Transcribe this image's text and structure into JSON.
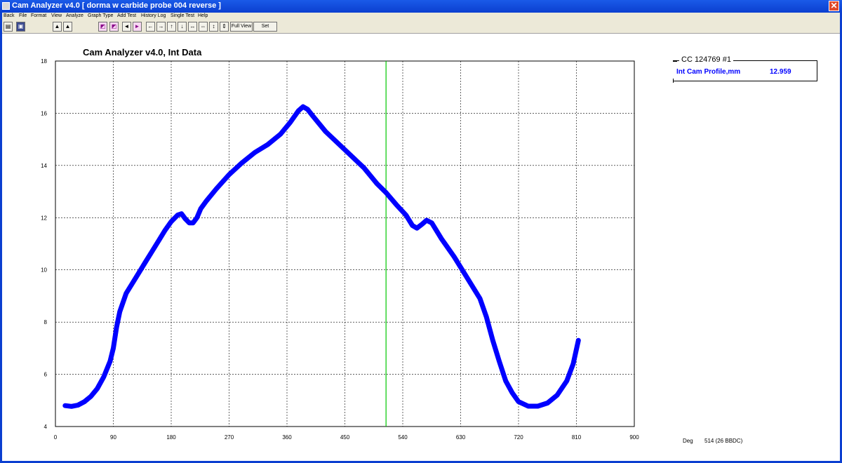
{
  "window": {
    "title": "Cam Analyzer v4.0  [ dorma w carbide probe 004 reverse ]",
    "close_glyph": "✕"
  },
  "menu": [
    "Back",
    "File",
    "Format",
    "View",
    "Analyze",
    "Graph Type",
    "Add Test",
    "History Log",
    "Single Test",
    "Help"
  ],
  "toolbar": {
    "buttons": [
      {
        "name": "print-icon",
        "glyph": "▤",
        "style": "normal"
      },
      {
        "name": "save-icon",
        "glyph": "▣",
        "style": "dark"
      },
      {
        "name": "graph-a-icon",
        "glyph": "▲",
        "style": "normal"
      },
      {
        "name": "graph-b-icon",
        "glyph": "▲",
        "style": "normal"
      },
      {
        "name": "chart-icon",
        "glyph": "◩",
        "style": "pink"
      },
      {
        "name": "chart-edit-icon",
        "glyph": "◩",
        "style": "pink"
      },
      {
        "name": "prev-icon",
        "glyph": "◄",
        "style": "normal"
      },
      {
        "name": "next-icon",
        "glyph": "►",
        "style": "pink"
      },
      {
        "name": "pan-left-icon",
        "glyph": "←",
        "style": "normal"
      },
      {
        "name": "pan-right-icon",
        "glyph": "→",
        "style": "normal"
      },
      {
        "name": "pan-up-icon",
        "glyph": "↑",
        "style": "normal"
      },
      {
        "name": "pan-down-icon",
        "glyph": "↓",
        "style": "normal"
      },
      {
        "name": "zoom-x-in-icon",
        "glyph": "↔",
        "style": "normal"
      },
      {
        "name": "zoom-x-out-icon",
        "glyph": "⇔",
        "style": "normal"
      },
      {
        "name": "zoom-y-in-icon",
        "glyph": "↕",
        "style": "normal"
      },
      {
        "name": "zoom-y-out-icon",
        "glyph": "⇕",
        "style": "normal"
      }
    ],
    "full_view_label": "Full View",
    "set_scales_label": "Set Scales"
  },
  "legend": {
    "title": "CC 124769 #1",
    "label": "Int Cam Profile,mm",
    "value": "12.959",
    "color": "#0000ff"
  },
  "status": {
    "deg_label": "Deg",
    "deg_value": "514 (26 BBDC)"
  },
  "chart_data": {
    "type": "line",
    "title": "Cam Analyzer v4.0,   Int Data",
    "xlabel": "",
    "ylabel": "",
    "xlim": [
      0,
      900
    ],
    "ylim": [
      4,
      18
    ],
    "x_ticks": [
      "0",
      "90",
      "180",
      "270",
      "360",
      "450",
      "540",
      "630",
      "720",
      "810",
      "900"
    ],
    "y_ticks": [
      "4",
      "6",
      "8",
      "10",
      "12",
      "14",
      "16",
      "18"
    ],
    "grid": true,
    "cursor_x": 514,
    "cursor_color": "#00c800",
    "series": [
      {
        "name": "Int Cam Profile,mm",
        "color": "#0000ff",
        "points": [
          [
            15,
            4.8
          ],
          [
            25,
            4.77
          ],
          [
            35,
            4.82
          ],
          [
            45,
            4.95
          ],
          [
            55,
            5.15
          ],
          [
            65,
            5.45
          ],
          [
            75,
            5.9
          ],
          [
            85,
            6.5
          ],
          [
            90,
            7.0
          ],
          [
            95,
            7.8
          ],
          [
            100,
            8.4
          ],
          [
            110,
            9.1
          ],
          [
            120,
            9.5
          ],
          [
            130,
            9.9
          ],
          [
            140,
            10.3
          ],
          [
            150,
            10.7
          ],
          [
            160,
            11.1
          ],
          [
            170,
            11.5
          ],
          [
            180,
            11.85
          ],
          [
            190,
            12.1
          ],
          [
            196,
            12.15
          ],
          [
            202,
            11.95
          ],
          [
            208,
            11.8
          ],
          [
            214,
            11.8
          ],
          [
            220,
            12.0
          ],
          [
            226,
            12.35
          ],
          [
            235,
            12.65
          ],
          [
            250,
            13.1
          ],
          [
            270,
            13.65
          ],
          [
            290,
            14.1
          ],
          [
            310,
            14.5
          ],
          [
            330,
            14.8
          ],
          [
            350,
            15.2
          ],
          [
            365,
            15.65
          ],
          [
            378,
            16.1
          ],
          [
            385,
            16.25
          ],
          [
            392,
            16.15
          ],
          [
            400,
            15.9
          ],
          [
            420,
            15.3
          ],
          [
            450,
            14.6
          ],
          [
            480,
            13.9
          ],
          [
            500,
            13.3
          ],
          [
            514,
            12.96
          ],
          [
            530,
            12.5
          ],
          [
            545,
            12.1
          ],
          [
            555,
            11.7
          ],
          [
            562,
            11.6
          ],
          [
            570,
            11.75
          ],
          [
            577,
            11.9
          ],
          [
            585,
            11.8
          ],
          [
            600,
            11.2
          ],
          [
            620,
            10.5
          ],
          [
            640,
            9.7
          ],
          [
            660,
            8.9
          ],
          [
            670,
            8.2
          ],
          [
            680,
            7.3
          ],
          [
            690,
            6.5
          ],
          [
            700,
            5.75
          ],
          [
            710,
            5.3
          ],
          [
            720,
            4.95
          ],
          [
            735,
            4.78
          ],
          [
            750,
            4.78
          ],
          [
            765,
            4.9
          ],
          [
            780,
            5.2
          ],
          [
            795,
            5.75
          ],
          [
            805,
            6.4
          ],
          [
            813,
            7.3
          ]
        ]
      }
    ]
  }
}
